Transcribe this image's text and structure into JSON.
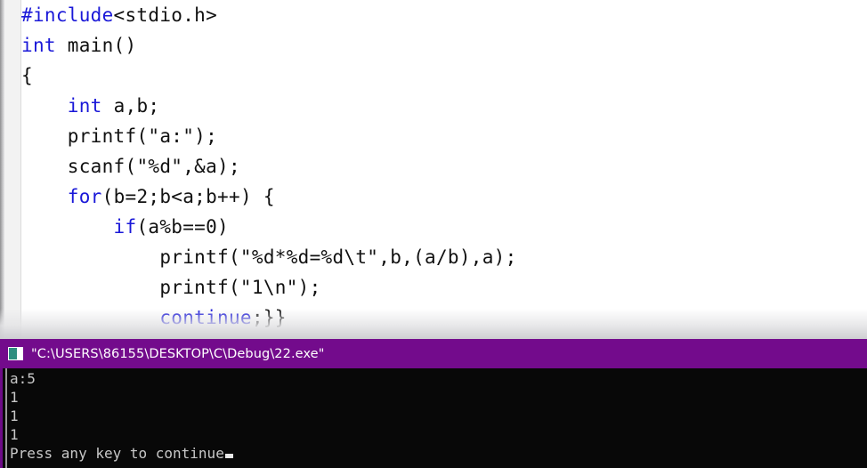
{
  "editor": {
    "name": "code-editor",
    "language": "c",
    "gutter_visible": true,
    "lines": [
      {
        "indent": 0,
        "tokens": [
          {
            "t": "#include",
            "c": "kw"
          },
          {
            "t": "<stdio.h>",
            "c": "pl"
          }
        ]
      },
      {
        "indent": 0,
        "tokens": [
          {
            "t": "int",
            "c": "kw"
          },
          {
            "t": " main()",
            "c": "pl"
          }
        ]
      },
      {
        "indent": 0,
        "tokens": [
          {
            "t": "{",
            "c": "pl"
          }
        ]
      },
      {
        "indent": 4,
        "tokens": [
          {
            "t": "int",
            "c": "kw"
          },
          {
            "t": " a,b;",
            "c": "pl"
          }
        ]
      },
      {
        "indent": 4,
        "tokens": [
          {
            "t": "printf(\"a:\");",
            "c": "pl"
          }
        ]
      },
      {
        "indent": 4,
        "tokens": [
          {
            "t": "scanf(\"%d\",&a);",
            "c": "pl"
          }
        ]
      },
      {
        "indent": 4,
        "tokens": [
          {
            "t": "for",
            "c": "kw"
          },
          {
            "t": "(b=2;b<a;b++) {",
            "c": "pl"
          }
        ]
      },
      {
        "indent": 8,
        "tokens": [
          {
            "t": "if",
            "c": "kw"
          },
          {
            "t": "(a%b==0)",
            "c": "pl"
          }
        ]
      },
      {
        "indent": 12,
        "tokens": [
          {
            "t": "printf(\"%d*%d=%d\\t\",b,(a/b),a);",
            "c": "pl"
          }
        ]
      },
      {
        "indent": 12,
        "tokens": [
          {
            "t": "printf(\"1\\n\");",
            "c": "pl"
          }
        ]
      },
      {
        "indent": 12,
        "tokens": [
          {
            "t": "continue",
            "c": "kw"
          },
          {
            "t": ";}}",
            "c": "pl"
          }
        ]
      }
    ],
    "colors": {
      "keyword": "#1a18d8",
      "plain": "#111111",
      "background": "#ffffff",
      "gutter": "#f2f2f2"
    }
  },
  "console": {
    "titlebar": {
      "title": "\"C:\\USERS\\86155\\DESKTOP\\C\\Debug\\22.exe\"",
      "icon": "console-window-icon",
      "background_color": "#6d0b87",
      "text_color": "#ffffff"
    },
    "body": {
      "background_color": "#080808",
      "text_color": "#c8c8c8",
      "lines": [
        "a:5",
        "1",
        "1",
        "1",
        "Press any key to continue"
      ],
      "cursor": "block"
    }
  }
}
